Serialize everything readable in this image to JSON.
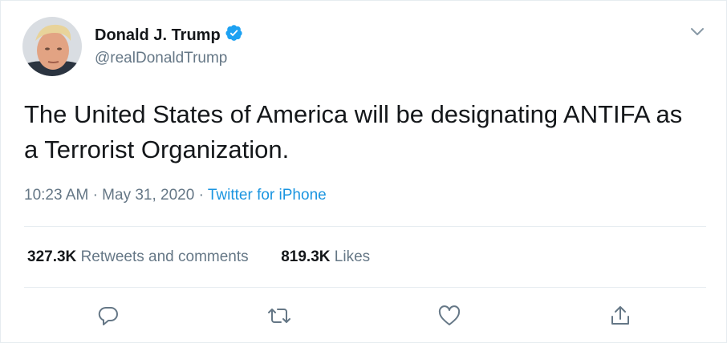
{
  "tweet": {
    "display_name": "Donald J. Trump",
    "handle": "@realDonaldTrump",
    "verified": true,
    "text": "The United States of America will be designating ANTIFA as a Terrorist Organization.",
    "time": "10:23 AM",
    "date": "May 31, 2020",
    "source": "Twitter for iPhone",
    "retweets_count": "327.3K",
    "retweets_label": "Retweets and comments",
    "likes_count": "819.3K",
    "likes_label": "Likes"
  },
  "icons": {
    "verified": "verified-badge-icon",
    "more": "chevron-down-icon",
    "reply": "reply-icon",
    "retweet": "retweet-icon",
    "like": "heart-icon",
    "share": "share-icon"
  },
  "colors": {
    "text": "#14171a",
    "muted": "#657786",
    "link": "#1b95e0",
    "verified": "#1da1f2",
    "divider": "#e6ecf0"
  }
}
